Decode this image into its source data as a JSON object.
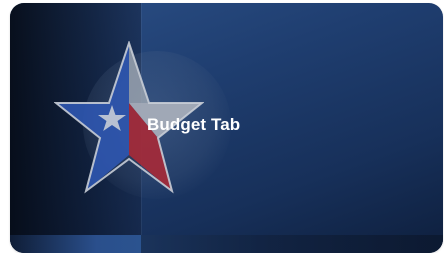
{
  "card": {
    "title": "Budget Tab",
    "icon": "texas-star-icon",
    "colors": {
      "background_top": "#2b4f86",
      "background_bottom": "#0e1f3d",
      "star_blue": "#2f56b0",
      "star_red": "#a52a38",
      "star_white": "#9aa3b0",
      "star_small": "#c8cdd6",
      "title_text": "#ffffff"
    }
  }
}
